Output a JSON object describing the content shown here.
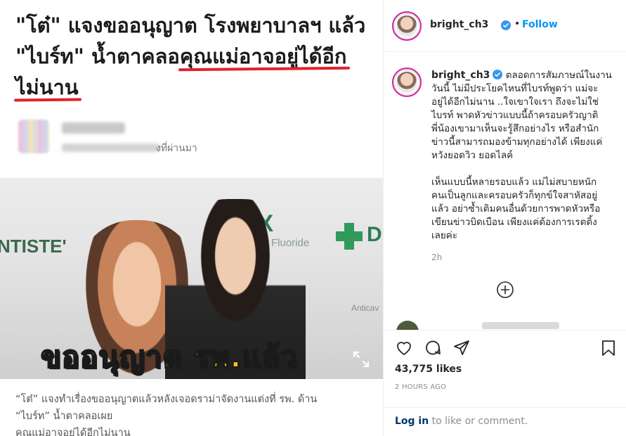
{
  "post_image": {
    "headline_line1": "\"โต๋\" แจงขออนุญาต โรงพยาบาลฯ แล้ว",
    "headline_line2_plain": "\"ไบร์ท\" น้ำตาคลอ",
    "headline_line2_underlined": "คุณแม่อาจอยู่ได้อีก",
    "headline_line3_underlined": "ไม่นาน",
    "author_time_suffix": "งที่ผ่านมา",
    "photo_wall_text_1": "NTISTE'",
    "photo_wall_text_2": "AX",
    "photo_wall_text_3": "Fluoride",
    "photo_wall_text_4": "D",
    "photo_wall_text_5": "Anticav",
    "photo_overlay_text": "ขออนุญาต รพ.แล้ว",
    "caption_line1": "“โต๋” แจงทำเรื่องขออนุญาตแล้วหลังเจอดราม่าจัดงานแต่งที่ รพ. ด้าน",
    "caption_line2_plain": "“ไบร์ท” น้ำตาคลอเผย",
    "caption_line2_underlined": "คุณแม่อาจอยู่ได้อีกไม่นาน"
  },
  "header": {
    "username": "bright_ch3",
    "separator": "•",
    "follow_label": "Follow"
  },
  "comment": {
    "username": "bright_ch3",
    "lines_p1": [
      "ตลอดการสัมภาษณ์ในงาน",
      "วันนี้ ไม่มีประโยคไหนที่ไบรท์พูดว่า แม่จะ",
      "อยู่ได้อีกไม่นาน ..ใจเขาใจเรา ถึงจะไม่ใช่",
      "ไบรท์ พาดหัวข่าวแบบนี้ถ้าครอบครัวญาติ",
      "พี่น้องเขามาเห็นจะรู้สึกอย่างไร หรือสำนัก",
      "ข่าวนี้สามารถมองข้ามทุกอย่างได้ เพียงแค่",
      "หวังยอดวิว ยอดไลค์"
    ],
    "lines_p2": [
      "เห็นแบบนี้หลายรอบแล้ว แม่ไม่สบายหนัก",
      "คนเป็นลูกและครอบครัวก็ทุกข์ใจสาหัสอยู่",
      "แล้ว อย่าซ้ำเติมคนอื่นด้วยการพาดหัวหรือ",
      "เขียนข่าวบิดเบือน เพียงแค่ต้องการเรตติ้ง",
      "เลยค่ะ"
    ],
    "time_ago": "2h"
  },
  "actions": {
    "likes": "43,775 likes",
    "posted": "2 HOURS AGO"
  },
  "login": {
    "link": "Log in",
    "rest": " to like or comment."
  },
  "colors": {
    "accent": "#0095f6",
    "underline_red": "#e0222a",
    "overlay_yellow": "#f6c61c"
  },
  "icons": [
    "expand-icon",
    "verified-badge-icon",
    "add-circle-icon",
    "heart-icon",
    "comment-icon",
    "share-icon",
    "bookmark-icon"
  ]
}
